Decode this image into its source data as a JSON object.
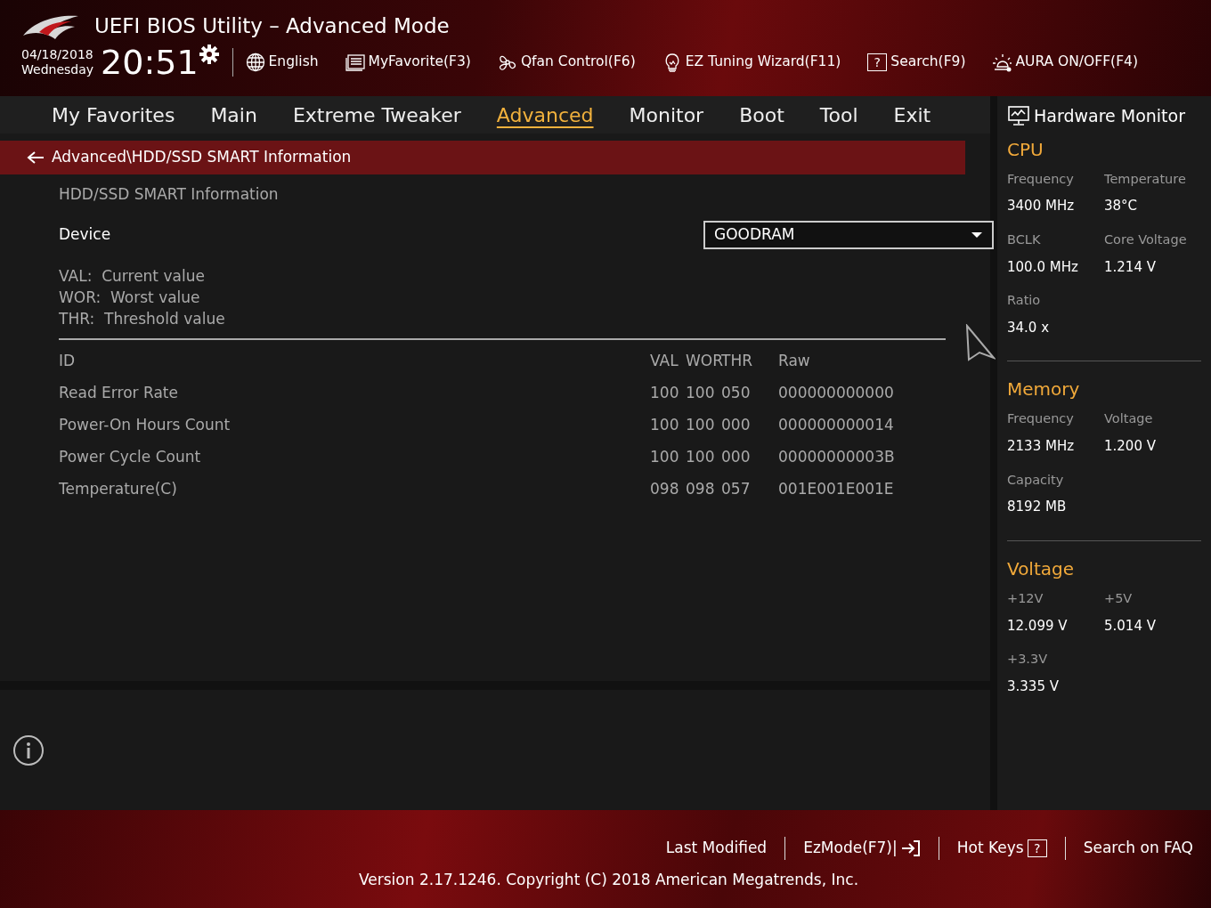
{
  "header": {
    "title": "UEFI BIOS Utility – Advanced Mode",
    "date": "04/18/2018",
    "weekday": "Wednesday",
    "time": "20:51",
    "tools": [
      {
        "kind": "globe",
        "label": "English"
      },
      {
        "kind": "list",
        "label": "MyFavorite(F3)"
      },
      {
        "kind": "fan",
        "label": "Qfan Control(F6)"
      },
      {
        "kind": "bulb",
        "label": "EZ Tuning Wizard(F11)"
      },
      {
        "kind": "help",
        "icon_text": "?",
        "label": "Search(F9)"
      },
      {
        "kind": "aura",
        "label": "AURA ON/OFF(F4)"
      }
    ]
  },
  "tabs": [
    {
      "label": "My Favorites",
      "selected": false
    },
    {
      "label": "Main",
      "selected": false
    },
    {
      "label": "Extreme Tweaker",
      "selected": false
    },
    {
      "label": "Advanced",
      "selected": true
    },
    {
      "label": "Monitor",
      "selected": false
    },
    {
      "label": "Boot",
      "selected": false
    },
    {
      "label": "Tool",
      "selected": false
    },
    {
      "label": "Exit",
      "selected": false
    }
  ],
  "breadcrumb": "Advanced\\HDD/SSD SMART Information",
  "section_title": "HDD/SSD SMART Information",
  "device": {
    "label": "Device",
    "value": "GOODRAM"
  },
  "legend": [
    {
      "key": "VAL:",
      "text": "Current value"
    },
    {
      "key": "WOR:",
      "text": "Worst value"
    },
    {
      "key": "THR:",
      "text": "Threshold value"
    }
  ],
  "table": {
    "columns": [
      "ID",
      "VAL",
      "WOR",
      "THR",
      "Raw"
    ],
    "rows": [
      [
        "Read Error Rate",
        "100",
        "100",
        "050",
        "000000000000"
      ],
      [
        "Power-On Hours Count",
        "100",
        "100",
        "000",
        "000000000014"
      ],
      [
        "Power Cycle Count",
        "100",
        "100",
        "000",
        "00000000003B"
      ],
      [
        "Temperature(C)",
        "098",
        "098",
        "057",
        "001E001E001E"
      ]
    ]
  },
  "hardware_monitor": {
    "title": "Hardware Monitor",
    "sections": [
      {
        "title": "CPU",
        "items": [
          {
            "label": "Frequency",
            "value": "3400 MHz"
          },
          {
            "label": "Temperature",
            "value": "38°C"
          },
          {
            "label": "BCLK",
            "value": "100.0 MHz"
          },
          {
            "label": "Core Voltage",
            "value": "1.214 V"
          },
          {
            "label": "Ratio",
            "value": "34.0 x"
          }
        ]
      },
      {
        "title": "Memory",
        "items": [
          {
            "label": "Frequency",
            "value": "2133 MHz"
          },
          {
            "label": "Voltage",
            "value": "1.200 V"
          },
          {
            "label": "Capacity",
            "value": "8192 MB"
          }
        ]
      },
      {
        "title": "Voltage",
        "items": [
          {
            "label": "+12V",
            "value": "12.099 V"
          },
          {
            "label": "+5V",
            "value": "5.014 V"
          },
          {
            "label": "+3.3V",
            "value": "3.335 V"
          }
        ]
      }
    ]
  },
  "footer": {
    "links": [
      {
        "kind": "plain",
        "label": "Last Modified"
      },
      {
        "kind": "exit",
        "label": "EzMode(F7)|"
      },
      {
        "kind": "help",
        "label": "Hot Keys",
        "icon_text": "?"
      },
      {
        "kind": "plain",
        "label": "Search on FAQ"
      }
    ],
    "version": "Version 2.17.1246. Copyright (C) 2018 American Megatrends, Inc."
  }
}
